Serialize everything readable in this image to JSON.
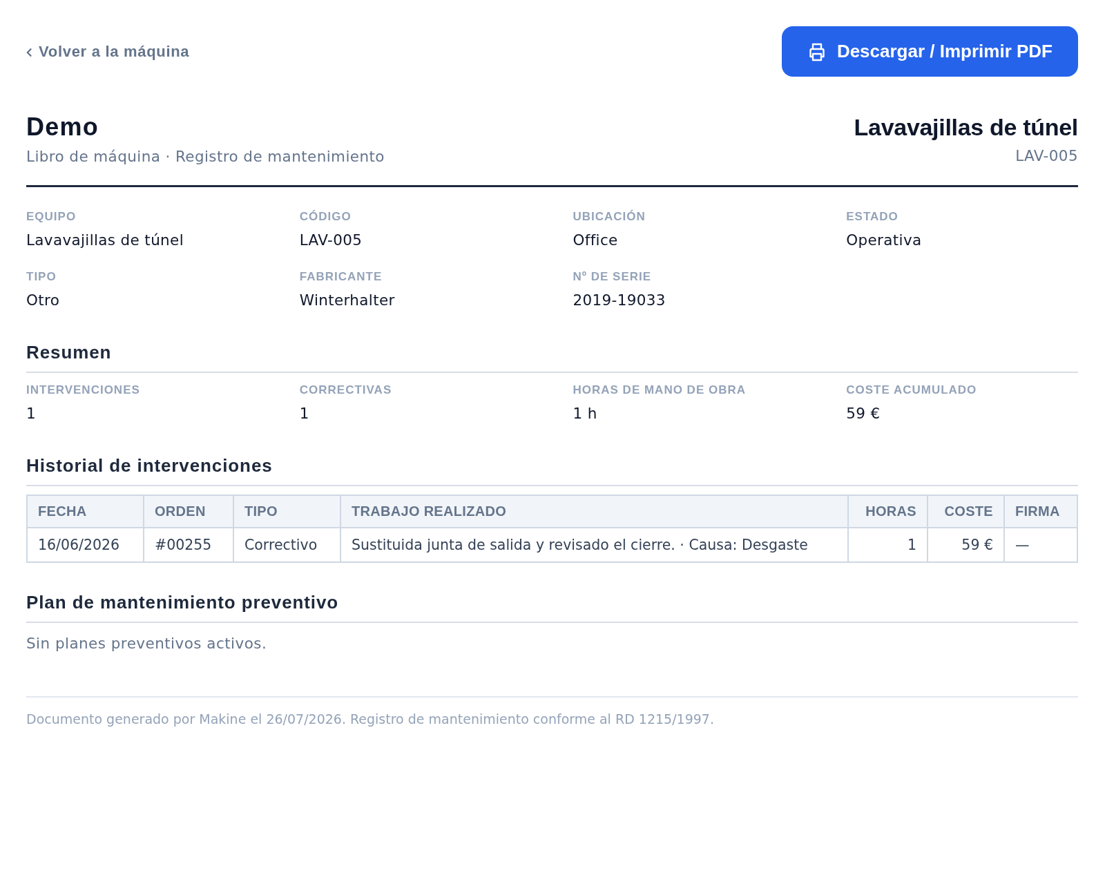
{
  "back_link": {
    "label": "Volver a la máquina"
  },
  "download_button": {
    "label": "Descargar / Imprimir PDF"
  },
  "header": {
    "company": "Demo",
    "subtitle": "Libro de máquina · Registro de mantenimiento",
    "machine_name": "Lavavajillas de túnel",
    "machine_code": "LAV-005"
  },
  "details": [
    {
      "label": "EQUIPO",
      "value": "Lavavajillas de túnel"
    },
    {
      "label": "CÓDIGO",
      "value": "LAV-005"
    },
    {
      "label": "UBICACIÓN",
      "value": "Office"
    },
    {
      "label": "ESTADO",
      "value": "Operativa"
    },
    {
      "label": "TIPO",
      "value": "Otro"
    },
    {
      "label": "FABRICANTE",
      "value": "Winterhalter"
    },
    {
      "label": "Nº DE SERIE",
      "value": "2019-19033"
    }
  ],
  "summary": {
    "title": "Resumen",
    "metrics": [
      {
        "label": "INTERVENCIONES",
        "value": "1"
      },
      {
        "label": "CORRECTIVAS",
        "value": "1"
      },
      {
        "label": "HORAS DE MANO DE OBRA",
        "value": "1 h"
      },
      {
        "label": "COSTE ACUMULADO",
        "value": "59 €"
      }
    ]
  },
  "history": {
    "title": "Historial de intervenciones",
    "table": {
      "columns": [
        {
          "label": "FECHA",
          "numeric": false
        },
        {
          "label": "ORDEN",
          "numeric": false
        },
        {
          "label": "TIPO",
          "numeric": false
        },
        {
          "label": "TRABAJO REALIZADO",
          "numeric": false
        },
        {
          "label": "HORAS",
          "numeric": true
        },
        {
          "label": "COSTE",
          "numeric": true
        },
        {
          "label": "FIRMA",
          "numeric": false
        }
      ],
      "rows": [
        [
          "16/06/2026",
          "#00255",
          "Correctivo",
          "Sustituida junta de salida y revisado el cierre. · Causa: Desgaste",
          "1",
          "59 €",
          "—"
        ]
      ]
    }
  },
  "preventive_plan": {
    "title": "Plan de mantenimiento preventivo",
    "empty_message": "Sin planes preventivos activos."
  },
  "footer": {
    "text": "Documento generado por Makine el 26/07/2026. Registro de mantenimiento conforme al RD 1215/1997."
  }
}
